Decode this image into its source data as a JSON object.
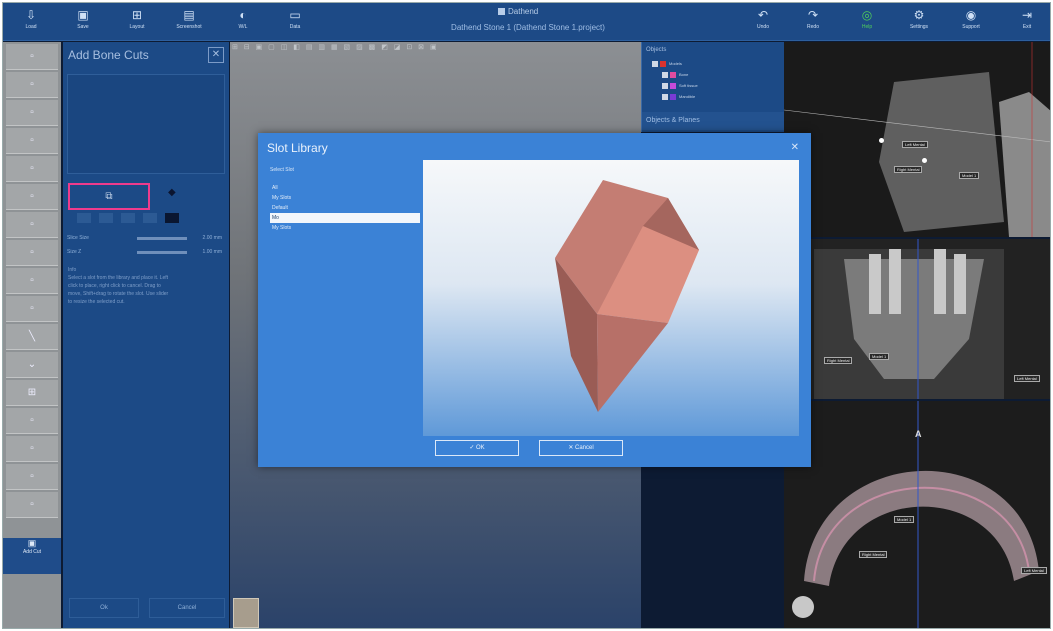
{
  "app": {
    "title": "Dathend Stone 1 (Dathend Stone 1.project)",
    "logo_text": "Dathend"
  },
  "toolbar": {
    "items": [
      {
        "label": "Load",
        "icon": "load-icon"
      },
      {
        "label": "Save",
        "icon": "save-icon"
      },
      {
        "label": "Layout",
        "icon": "layout-icon"
      },
      {
        "label": "Screenshot",
        "icon": "screenshot-icon"
      },
      {
        "label": "W/L",
        "icon": "contrast-icon"
      },
      {
        "label": "Data",
        "icon": "data-icon"
      },
      {
        "label": "Undo",
        "icon": "undo-icon"
      },
      {
        "label": "Redo",
        "icon": "redo-icon"
      },
      {
        "label": "Help",
        "icon": "help-icon"
      },
      {
        "label": "Settings",
        "icon": "settings-icon"
      },
      {
        "label": "Support",
        "icon": "support-icon"
      },
      {
        "label": "Exit",
        "icon": "exit-icon"
      }
    ]
  },
  "sidebar": {
    "selected_label": "Add Cut",
    "items_count": 17
  },
  "panel": {
    "title": "Add Bone Cuts",
    "close_label": "✕",
    "add_slot_label": "⧉",
    "sliders": [
      {
        "label": "Slice Size",
        "value": "2.00 mm"
      },
      {
        "label": "Size Z",
        "value": "1.00 mm"
      }
    ],
    "info_lines": [
      "Info",
      "Select a slot from the library and place it. Left",
      "click to place, right click to cancel. Drag to",
      "move, Shift+drag to rotate the slot. Use slider",
      "to resize the selected cut."
    ],
    "bottom_buttons": [
      "Ok",
      "Cancel"
    ]
  },
  "viewport": {
    "toolbar_strip": "⊞ ⊟ ▣ ▢ ◫ ◧ ▤ ▥ ▦ ▧ ▨ ▩ ◩ ◪ ⊡ ⊠ ▣"
  },
  "objects": {
    "title": "Objects",
    "rows": [
      {
        "label": "Models",
        "color": "#d9332f"
      },
      {
        "label": "Bone",
        "color": "#e04ca0"
      },
      {
        "label": "Soft tissue",
        "color": "#c64bd9"
      },
      {
        "label": "Mandible",
        "color": "#7a3bd6"
      }
    ],
    "section": "Objects & Planes"
  },
  "slices": {
    "sagittal_labels": [
      "Left Mental",
      "Right Mental",
      "Model 1"
    ],
    "coronal_labels": [
      "Right Mental",
      "Model 1",
      "Left Mental"
    ],
    "axial_labels": [
      "Model 1",
      "Right Mental",
      "Left Mental"
    ],
    "axial_marker": "A"
  },
  "modal": {
    "title": "Slot Library",
    "close_label": "✕",
    "list_label": "Select Slot",
    "list_items": [
      "All",
      "My Slots",
      "Default",
      "Mo",
      "My Slots"
    ],
    "selected_index": 3,
    "ok_label": "✓  OK",
    "cancel_label": "✕  Cancel"
  },
  "colors": {
    "accent": "#3b82d6",
    "panel": "#1c4a86",
    "highlight": "#ee3b8c",
    "slot_shape": "#d68a7e"
  }
}
